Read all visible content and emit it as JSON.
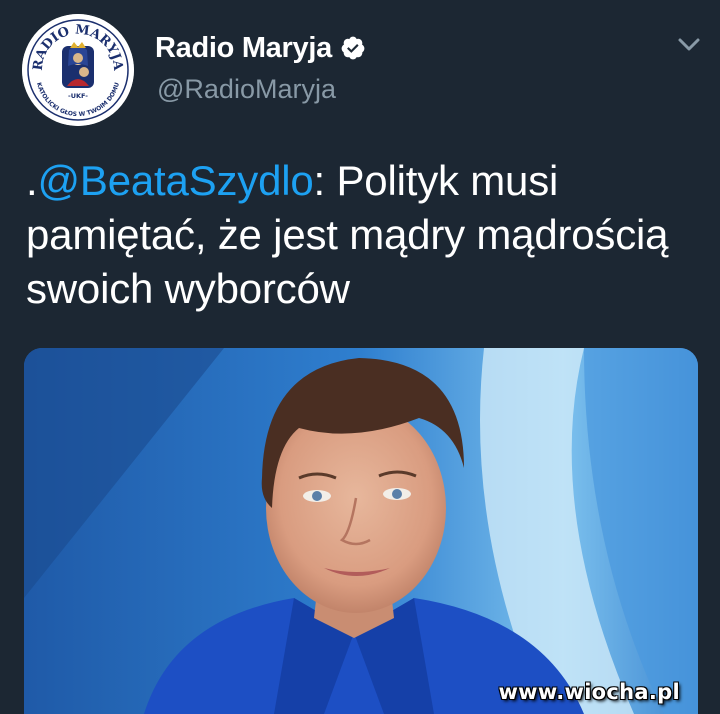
{
  "tweet": {
    "author": {
      "display_name": "Radio Maryja",
      "handle": "@RadioMaryja",
      "verified": true,
      "avatar_text_top": "RADIO MARYJA",
      "avatar_text_bottom": "KATOLICKI GŁOS W TWOIM DOMU",
      "avatar_badge": "-UKF-"
    },
    "text_prefix": ".",
    "mention": "@BeataSzydlo",
    "text_body": ": Polityk musi pamiętać, że jest mądry mądrością swoich wyborców",
    "media": {
      "watermark": "www.wiocha.pl"
    }
  },
  "colors": {
    "background": "#1c2733",
    "link": "#1da1f2",
    "secondary_text": "#8899a6"
  },
  "icons": {
    "verified": "verified-badge-icon",
    "menu": "chevron-down-icon"
  }
}
